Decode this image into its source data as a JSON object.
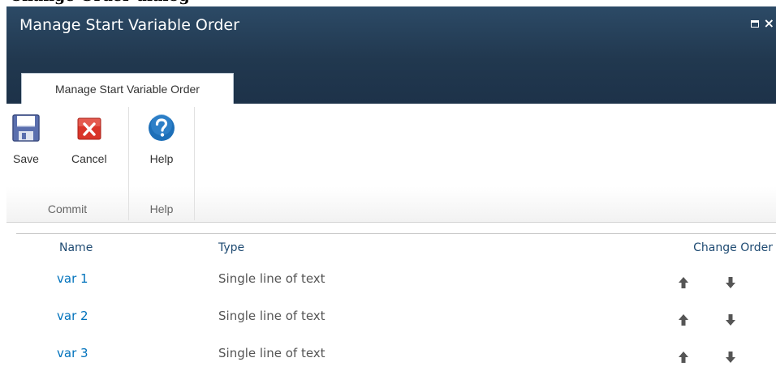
{
  "page_caption": "Change Order dialog",
  "dialog": {
    "title": "Manage Start Variable Order",
    "maximize_icon": "maximize-icon",
    "close_icon": "close-icon",
    "close_glyph": "×"
  },
  "ribbon": {
    "tab_label": "Manage Start Variable Order",
    "groups": {
      "commit": {
        "label": "Commit",
        "save_label": "Save",
        "cancel_label": "Cancel"
      },
      "help": {
        "label": "Help",
        "help_label": "Help"
      }
    },
    "icons": {
      "save": "floppy-disk-icon",
      "cancel": "red-x-icon",
      "help": "question-mark-icon"
    }
  },
  "table": {
    "headers": {
      "name": "Name",
      "type": "Type",
      "change_order": "Change Order"
    },
    "rows": [
      {
        "name": "var 1",
        "type": "Single line of text"
      },
      {
        "name": "var 2",
        "type": "Single line of text"
      },
      {
        "name": "var 3",
        "type": "Single line of text"
      }
    ],
    "arrow_icons": {
      "up": "arrow-up-icon",
      "down": "arrow-down-icon"
    }
  },
  "colors": {
    "title_bar": "#21384f",
    "link": "#0072bc",
    "header_text": "#1e4a72",
    "cancel_red": "#d9352a",
    "help_blue": "#1d6fb8"
  }
}
